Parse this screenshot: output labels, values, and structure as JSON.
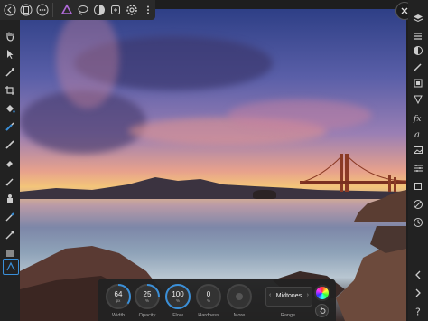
{
  "top_toolbar": {
    "icons": [
      "back-icon",
      "document-icon",
      "more-icon",
      "designer-persona-icon",
      "lasso-icon",
      "develop-persona-icon",
      "export-persona-icon",
      "settings-icon",
      "kebab-icon"
    ]
  },
  "left_toolbar": {
    "tools": [
      "hand-tool",
      "move-tool",
      "color-picker-tool",
      "crop-tool",
      "fill-tool",
      "selection-brush-tool",
      "paint-brush-tool",
      "erase-tool",
      "clone-tool",
      "dodge-tool",
      "smudge-tool",
      "retouch-tool",
      "frame-tool",
      "vector-tool"
    ]
  },
  "right_toolbar": {
    "studios": [
      "layers",
      "adjustments",
      "brushes",
      "color",
      "transform",
      "navigator",
      "effects",
      "styles",
      "stock",
      "character",
      "history",
      "channels",
      "snapshot",
      "help"
    ]
  },
  "context_toolbar": {
    "width": {
      "value": "64",
      "unit": "px",
      "label": "Width",
      "level": 0.35
    },
    "opacity": {
      "value": "25",
      "unit": "%",
      "label": "Opacity",
      "level": 0.25
    },
    "flow": {
      "value": "100",
      "unit": "%",
      "label": "Flow",
      "level": 1.0
    },
    "hardness": {
      "value": "0",
      "unit": "%",
      "label": "Hardness",
      "level": 0.0
    },
    "more": {
      "value": "",
      "unit": "",
      "label": "More"
    },
    "range": {
      "value": "Midtones",
      "label": "Range"
    }
  },
  "colors": {
    "accent": "#3a8fd8",
    "persona_purple": "#b06ad8"
  }
}
